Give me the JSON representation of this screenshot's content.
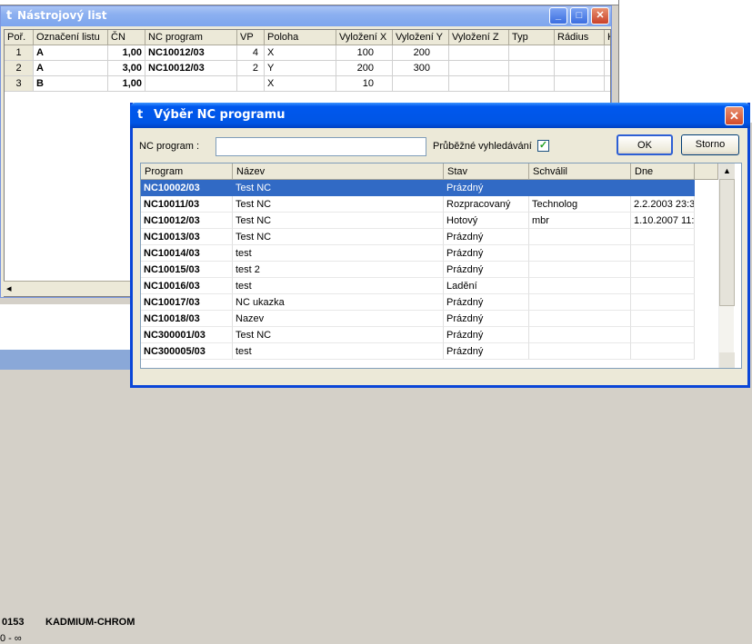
{
  "background": {
    "code": "0153",
    "name": "KADMIUM-CHROM",
    "range": "0 - ∞"
  },
  "tool_window": {
    "title": "Nástrojový list",
    "columns": [
      "Poř.",
      "Označení listu",
      "ČN",
      "NC program",
      "VP",
      "Poloha",
      "Vyložení X",
      "Vyložení Y",
      "Vyložení Z",
      "Typ",
      "Rádius",
      "K"
    ],
    "rows": [
      {
        "num": "1",
        "label": "A",
        "cn": "1,00",
        "program": "NC10012/03",
        "vp": "4",
        "poloha": "X",
        "x": "100",
        "y": "200"
      },
      {
        "num": "2",
        "label": "A",
        "cn": "3,00",
        "program": "NC10012/03",
        "vp": "2",
        "poloha": "Y",
        "x": "200",
        "y": "300"
      },
      {
        "num": "3",
        "label": "B",
        "cn": "1,00",
        "program": "",
        "vp": "",
        "poloha": "X",
        "x": "10",
        "y": ""
      }
    ],
    "scroll_left": "◂"
  },
  "nc_dialog": {
    "title": "Výběr NC programu",
    "close": "✕",
    "search_label": "NC program :",
    "search_value": "",
    "live_search_label": "Průběžné vyhledávání",
    "live_search_checked": "✓",
    "ok": "OK",
    "cancel": "Storno",
    "columns": [
      "Program",
      "Název",
      "Stav",
      "Schválil",
      "Dne"
    ],
    "rows": [
      {
        "program": "NC10002/03",
        "name": "Test NC",
        "state": "Prázdný",
        "approved": "",
        "date": "",
        "selected": true
      },
      {
        "program": "NC10011/03",
        "name": "Test NC",
        "state": "Rozpracovaný",
        "approved": "Technolog",
        "date": "2.2.2003 23:3:"
      },
      {
        "program": "NC10012/03",
        "name": "Test NC",
        "state": "Hotový",
        "approved": "mbr",
        "date": "1.10.2007 11:0"
      },
      {
        "program": "NC10013/03",
        "name": "Test NC",
        "state": "Prázdný",
        "approved": "",
        "date": ""
      },
      {
        "program": "NC10014/03",
        "name": "test",
        "state": "Prázdný",
        "approved": "",
        "date": ""
      },
      {
        "program": "NC10015/03",
        "name": "test 2",
        "state": "Prázdný",
        "approved": "",
        "date": ""
      },
      {
        "program": "NC10016/03",
        "name": "test",
        "state": "Ladění",
        "approved": "",
        "date": ""
      },
      {
        "program": "NC10017/03",
        "name": "NC ukazka",
        "state": "Prázdný",
        "approved": "",
        "date": ""
      },
      {
        "program": "NC10018/03",
        "name": "Nazev",
        "state": "Prázdný",
        "approved": "",
        "date": ""
      },
      {
        "program": "NC300001/03",
        "name": "Test NC",
        "state": "Prázdný",
        "approved": "",
        "date": ""
      },
      {
        "program": "NC300005/03",
        "name": "test",
        "state": "Prázdný",
        "approved": "",
        "date": ""
      }
    ],
    "scroll_up": "▲"
  }
}
